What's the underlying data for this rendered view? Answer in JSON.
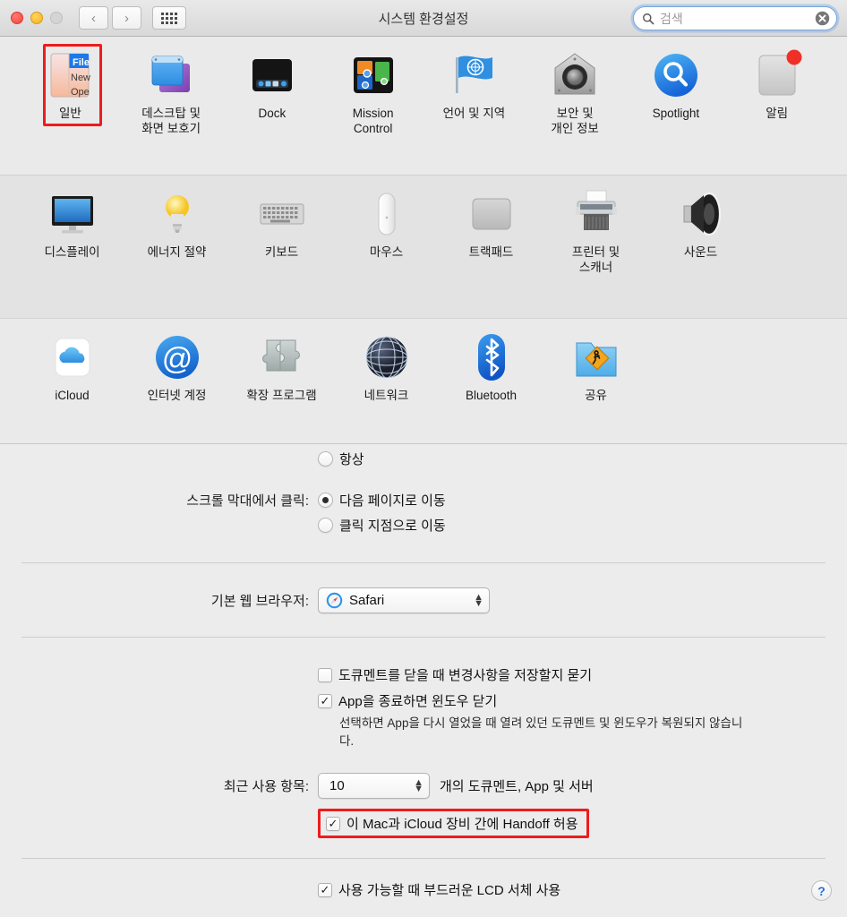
{
  "window": {
    "title": "시스템 환경설정",
    "traffic_lights": [
      "close",
      "minimize",
      "zoom-disabled"
    ],
    "nav": {
      "back": "‹",
      "forward": "›"
    },
    "grid_button": "show-all-grid"
  },
  "search": {
    "placeholder": "검색",
    "value": "",
    "icon": "search-icon",
    "clear_icon": "clear-circle-icon"
  },
  "pref_rows": [
    {
      "items": [
        {
          "label": "일반",
          "icon": "general-icon",
          "selected": true
        },
        {
          "label": "데스크탑 및\n화면 보호기",
          "icon": "desktop-screensaver-icon",
          "selected": false
        },
        {
          "label": "Dock",
          "icon": "dock-icon",
          "selected": false
        },
        {
          "label": "Mission\nControl",
          "icon": "mission-control-icon",
          "selected": false
        },
        {
          "label": "언어 및 지역",
          "icon": "language-region-flag-icon",
          "selected": false
        },
        {
          "label": "보안 및\n개인 정보",
          "icon": "security-privacy-icon",
          "selected": false
        },
        {
          "label": "Spotlight",
          "icon": "spotlight-icon",
          "selected": false
        },
        {
          "label": "알림",
          "icon": "notifications-icon",
          "selected": false
        }
      ]
    },
    {
      "items": [
        {
          "label": "디스플레이",
          "icon": "displays-icon",
          "selected": false
        },
        {
          "label": "에너지 절약",
          "icon": "energy-saver-bulb-icon",
          "selected": false
        },
        {
          "label": "키보드",
          "icon": "keyboard-icon",
          "selected": false
        },
        {
          "label": "마우스",
          "icon": "mouse-icon",
          "selected": false
        },
        {
          "label": "트랙패드",
          "icon": "trackpad-icon",
          "selected": false
        },
        {
          "label": "프린터 및\n스캐너",
          "icon": "printers-scanners-icon",
          "selected": false
        },
        {
          "label": "사운드",
          "icon": "sound-speaker-icon",
          "selected": false
        }
      ]
    },
    {
      "items": [
        {
          "label": "iCloud",
          "icon": "icloud-icon",
          "selected": false
        },
        {
          "label": "인터넷 계정",
          "icon": "internet-accounts-at-icon",
          "selected": false
        },
        {
          "label": "확장 프로그램",
          "icon": "extensions-puzzle-icon",
          "selected": false
        },
        {
          "label": "네트워크",
          "icon": "network-globe-icon",
          "selected": false
        },
        {
          "label": "Bluetooth",
          "icon": "bluetooth-icon",
          "selected": false
        },
        {
          "label": "공유",
          "icon": "sharing-folder-icon",
          "selected": false
        }
      ]
    }
  ],
  "settings": {
    "scrollbar_show": {
      "always_label": "항상",
      "always_selected": false
    },
    "scrollbar_click": {
      "label": "스크롤 막대에서 클릭:",
      "options": [
        {
          "label": "다음 페이지로 이동",
          "selected": true
        },
        {
          "label": "클릭 지점으로 이동",
          "selected": false
        }
      ]
    },
    "default_browser": {
      "label": "기본 웹 브라우저:",
      "value": "Safari",
      "icon": "safari-compass-icon"
    },
    "checkboxes": [
      {
        "label": "도큐멘트를 닫을 때 변경사항을 저장할지 묻기",
        "checked": false
      },
      {
        "label": "App을 종료하면 윈도우 닫기",
        "checked": true
      }
    ],
    "close_windows_hint": "선택하면 App을 다시 열었을 때 열려 있던 도큐멘트 및 윈도우가 복원되지 않습니다.",
    "recent_items": {
      "label": "최근 사용 항목:",
      "value": "10",
      "suffix": "개의 도큐멘트, App 및 서버"
    },
    "handoff": {
      "label": "이 Mac과 iCloud 장비 간에 Handoff 허용",
      "checked": true,
      "highlighted": true
    },
    "lcd_font": {
      "label": "사용 가능할 때 부드러운 LCD 서체 사용",
      "checked": true
    },
    "help_button": "?"
  },
  "colors": {
    "highlight_red": "#ee1c1c",
    "window_bg": "#ececec",
    "row_bg_light": "#eaeaea",
    "row_bg_dark": "#e3e3e3",
    "accent_blue": "#2b6fd6"
  },
  "checkmark_glyph": "✓"
}
